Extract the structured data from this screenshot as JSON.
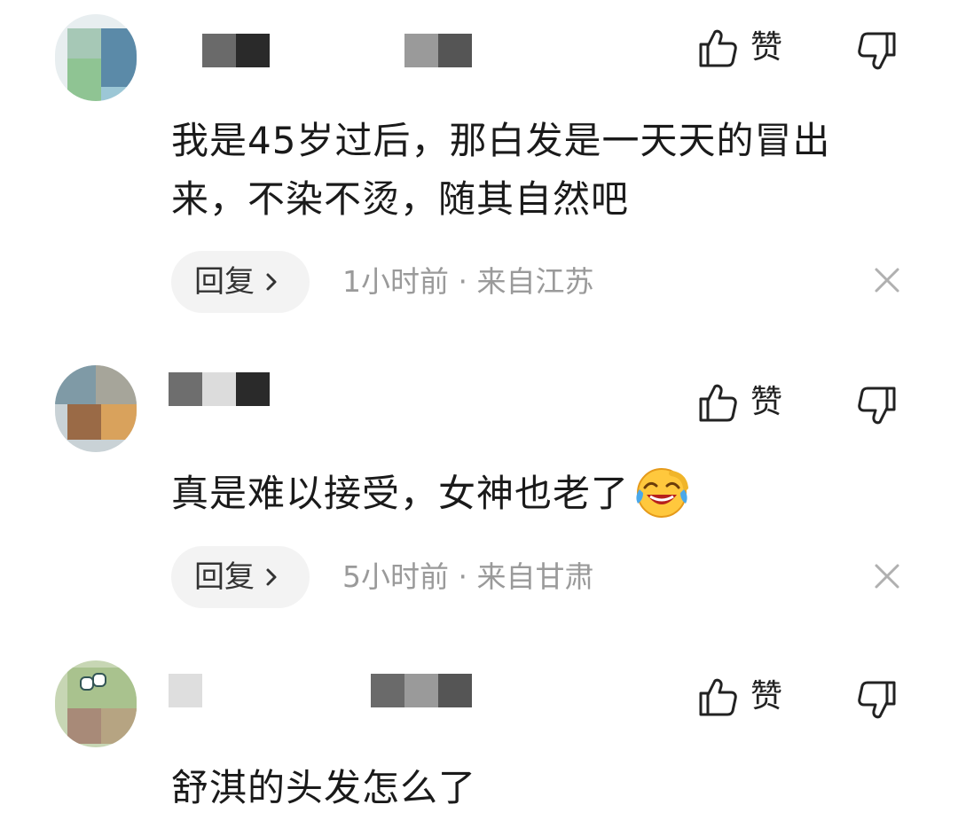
{
  "comments": [
    {
      "text": "我是45岁过后，那白发是一天天的冒出来，不染不烫，随其自然吧",
      "line1": "我是45岁过后，那白发是一天天的冒出",
      "line2": "来，不染不烫，随其自然吧",
      "like_label": "赞",
      "reply_label": "回复",
      "meta": "1小时前 · 来自江苏"
    },
    {
      "text": "真是难以接受，女神也老了",
      "line1": "真是难以接受，女神也老了",
      "like_label": "赞",
      "reply_label": "回复",
      "meta": "5小时前 · 来自甘肃"
    },
    {
      "text": "舒淇的头发怎么了",
      "line1": "舒淇的头发怎么了",
      "like_label": "赞"
    }
  ],
  "icons": {
    "like": "thumbs-up-icon",
    "dislike": "thumbs-down-icon",
    "reply_arrow": "chevron-right-icon",
    "close": "close-icon",
    "emoji": "laughing-crying-emoji"
  },
  "colors": {
    "meta_text": "#9a9a9a",
    "reply_bg": "#f3f3f3",
    "body_text": "#1a1a1a"
  }
}
